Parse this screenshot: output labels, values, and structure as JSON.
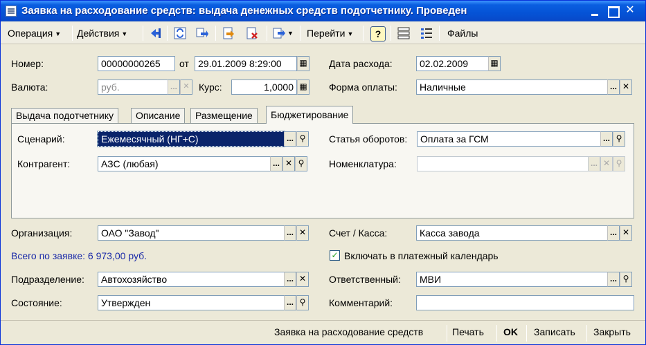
{
  "window": {
    "title": "Заявка на расходование средств: выдача денежных средств подотчетнику. Проведен"
  },
  "toolbar": {
    "operation_label": "Операция",
    "actions_label": "Действия",
    "goto_label": "Перейти",
    "help_label": "?",
    "files_label": "Файлы"
  },
  "header": {
    "number_label": "Номер:",
    "number_value": "00000000265",
    "from_label": "от",
    "date_value": "29.01.2009  8:29:00",
    "expense_date_label": "Дата расхода:",
    "expense_date_value": "02.02.2009",
    "currency_label": "Валюта:",
    "currency_value": "руб.",
    "rate_label": "Курс:",
    "rate_value": "1,0000",
    "payment_form_label": "Форма оплаты:",
    "payment_form_value": "Наличные"
  },
  "tabs": [
    {
      "label": "Выдача подотчетнику"
    },
    {
      "label": "Описание"
    },
    {
      "label": "Размещение"
    },
    {
      "label": "Бюджетирование"
    }
  ],
  "budget": {
    "scenario_label": "Сценарий:",
    "scenario_value": "Ежемесячный (НГ+С)",
    "contractor_label": "Контрагент:",
    "contractor_value": "АЗС (любая)",
    "turnover_label": "Статья оборотов:",
    "turnover_value": "Оплата за ГСМ",
    "nomenclature_label": "Номенклатура:",
    "nomenclature_value": ""
  },
  "footer_fields": {
    "organization_label": "Организация:",
    "organization_value": "ОАО \"Завод\"",
    "account_label": "Счет / Касса:",
    "account_value": "Касса завода",
    "total_text": "Всего по заявке: 6 973,00 руб.",
    "include_calendar_label": "Включать в платежный календарь",
    "include_calendar_checked": true,
    "department_label": "Подразделение:",
    "department_value": "Автохозяйство",
    "responsible_label": "Ответственный:",
    "responsible_value": "МВИ",
    "state_label": "Состояние:",
    "state_value": "Утвержден",
    "comment_label": "Комментарий:",
    "comment_value": ""
  },
  "bottom": {
    "print_form_label": "Заявка на расходование средств",
    "print_label": "Печать",
    "ok_label": "OK",
    "save_label": "Записать",
    "close_label": "Закрыть"
  },
  "icons": {
    "select": "...",
    "clear": "✕",
    "open": "🔍",
    "calendar": "▦",
    "calculator": "▦",
    "check": "✓"
  }
}
